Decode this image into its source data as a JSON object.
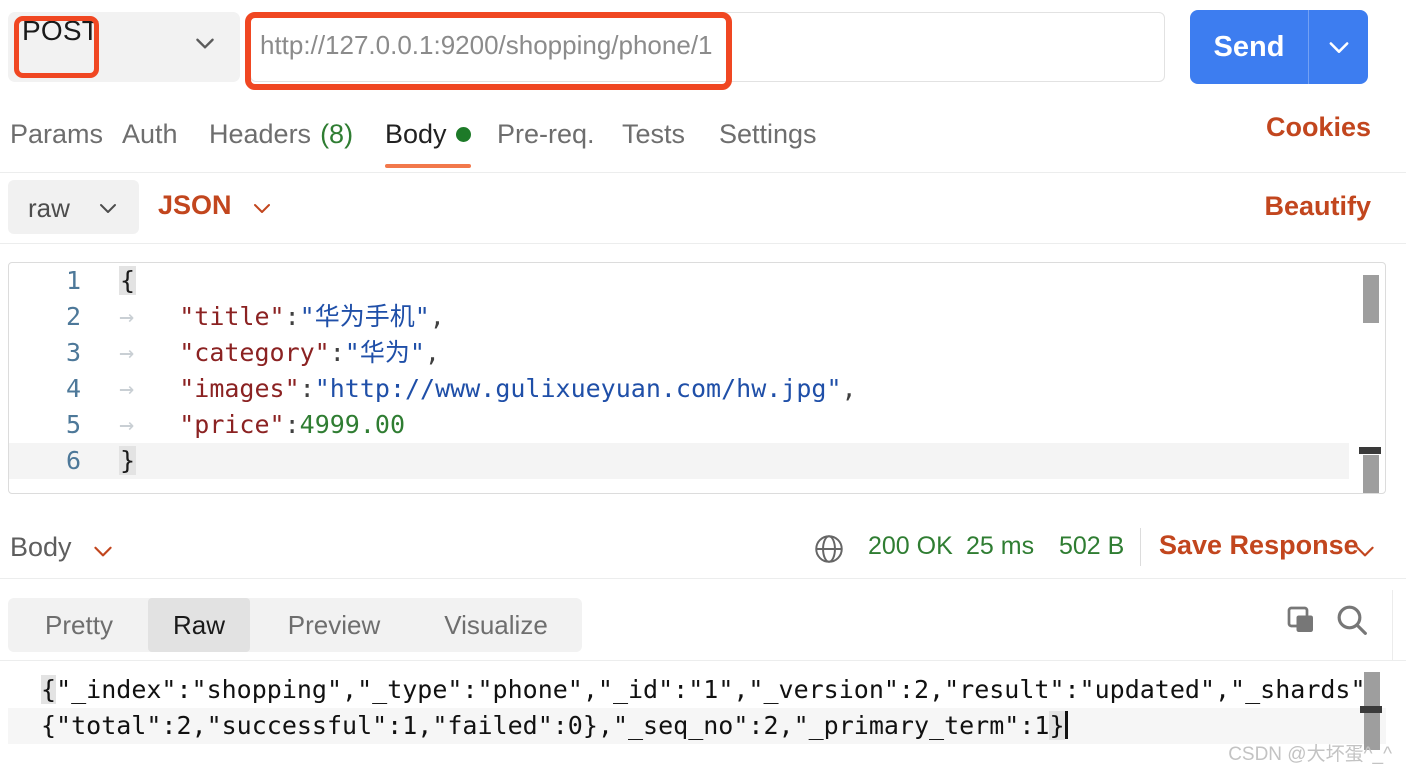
{
  "request_bar": {
    "method": "POST",
    "method_caret_icon": "chevron-down-icon",
    "url": "http://127.0.0.1:9200/shopping/phone/1",
    "send_label": "Send",
    "send_caret_icon": "chevron-down-icon",
    "annotation_color": "#f04722"
  },
  "request_tabs": {
    "items": [
      {
        "label": "Params",
        "active": false
      },
      {
        "label": "Auth",
        "active": false
      },
      {
        "label": "Headers",
        "count": "(8)",
        "active": false
      },
      {
        "label": "Body",
        "active": true,
        "dot": true
      },
      {
        "label": "Pre-req.",
        "active": false
      },
      {
        "label": "Tests",
        "active": false
      },
      {
        "label": "Settings",
        "active": false
      }
    ],
    "cookies_label": "Cookies",
    "active_color": "#f2784b"
  },
  "body_toolbar": {
    "mode": "raw",
    "mode_caret_icon": "chevron-down-icon",
    "format": "JSON",
    "format_caret_icon": "chevron-down-icon",
    "beautify_label": "Beautify",
    "accent_color": "#c2461e"
  },
  "request_editor": {
    "lines": [
      {
        "num": "1",
        "tab": false,
        "tokens": [
          {
            "t": "{",
            "c": "brace"
          }
        ]
      },
      {
        "num": "2",
        "tab": true,
        "tokens": [
          {
            "t": "\"title\"",
            "c": "k"
          },
          {
            "t": ":",
            "c": "p"
          },
          {
            "t": "\"华为手机\"",
            "c": "s"
          },
          {
            "t": ",",
            "c": "p"
          }
        ]
      },
      {
        "num": "3",
        "tab": true,
        "tokens": [
          {
            "t": "\"category\"",
            "c": "k"
          },
          {
            "t": ":",
            "c": "p"
          },
          {
            "t": "\"华为\"",
            "c": "s"
          },
          {
            "t": ",",
            "c": "p"
          }
        ]
      },
      {
        "num": "4",
        "tab": true,
        "tokens": [
          {
            "t": "\"images\"",
            "c": "k"
          },
          {
            "t": ":",
            "c": "p"
          },
          {
            "t": "\"http://www.gulixueyuan.com/hw.jpg\"",
            "c": "s"
          },
          {
            "t": ",",
            "c": "p"
          }
        ]
      },
      {
        "num": "5",
        "tab": true,
        "tokens": [
          {
            "t": "\"price\"",
            "c": "k"
          },
          {
            "t": ":",
            "c": "p"
          },
          {
            "t": "4999.00",
            "c": "n"
          }
        ]
      },
      {
        "num": "6",
        "tab": false,
        "tokens": [
          {
            "t": "}",
            "c": "brace"
          }
        ]
      }
    ],
    "tab_arrow": "→"
  },
  "response_meta": {
    "body_label": "Body",
    "body_caret_icon": "chevron-down-icon",
    "globe_icon": "globe-icon",
    "status": "200 OK",
    "time": "25 ms",
    "size": "502 B",
    "save_label": "Save Response",
    "save_caret_icon": "chevron-down-icon",
    "status_color": "#2f7d32"
  },
  "response_tabs": {
    "items": [
      {
        "label": "Pretty",
        "active": false
      },
      {
        "label": "Raw",
        "active": true
      },
      {
        "label": "Preview",
        "active": false
      },
      {
        "label": "Visualize",
        "active": false
      }
    ],
    "copy_icon": "copy-icon",
    "search_icon": "search-icon"
  },
  "response_body": {
    "line1_pre": "{",
    "line1": "\"_index\":\"shopping\",\"_type\":\"phone\",\"_id\":\"1\",\"_version\":2,\"result\":\"updated\",\"_shards\":",
    "line2": "{\"total\":2,\"successful\":1,\"failed\":0},\"_seq_no\":2,\"_primary_term\":1",
    "line2_end": "}",
    "full_text": "{\"_index\":\"shopping\",\"_type\":\"phone\",\"_id\":\"1\",\"_version\":2,\"result\":\"updated\",\"_shards\":{\"total\":2,\"successful\":1,\"failed\":0},\"_seq_no\":2,\"_primary_term\":1}"
  },
  "watermark": {
    "text": "CSDN @大坏蛋^_^"
  }
}
